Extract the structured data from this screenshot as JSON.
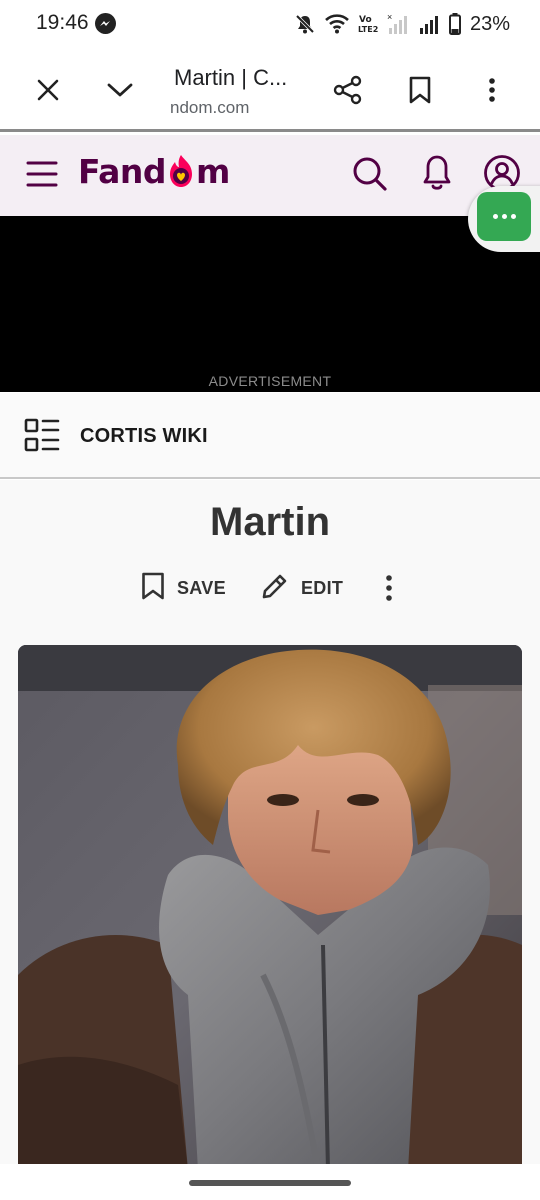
{
  "status_bar": {
    "time": "19:46",
    "battery": "23%"
  },
  "browser": {
    "title": "Martin | C...",
    "domain": "ndom.com"
  },
  "fandom": {
    "logo_text_left": "Fand",
    "logo_text_right": "m",
    "brand_color": "#520044",
    "accent_color": "#fa005a"
  },
  "ad": {
    "label": "ADVERTISEMENT"
  },
  "wiki": {
    "name": "CORTIS WIKI"
  },
  "page": {
    "title": "Martin",
    "save_label": "SAVE",
    "edit_label": "EDIT"
  },
  "icons": [
    "messenger-icon",
    "mute-icon",
    "wifi-icon",
    "volte-icon",
    "signal-icon",
    "battery-icon",
    "close-icon",
    "chevron-down-icon",
    "share-icon",
    "bookmark-icon",
    "more-vert-icon",
    "menu-icon",
    "search-icon",
    "bell-icon",
    "user-icon",
    "chat-icon",
    "wiki-grid-icon",
    "edit-pencil-icon"
  ]
}
